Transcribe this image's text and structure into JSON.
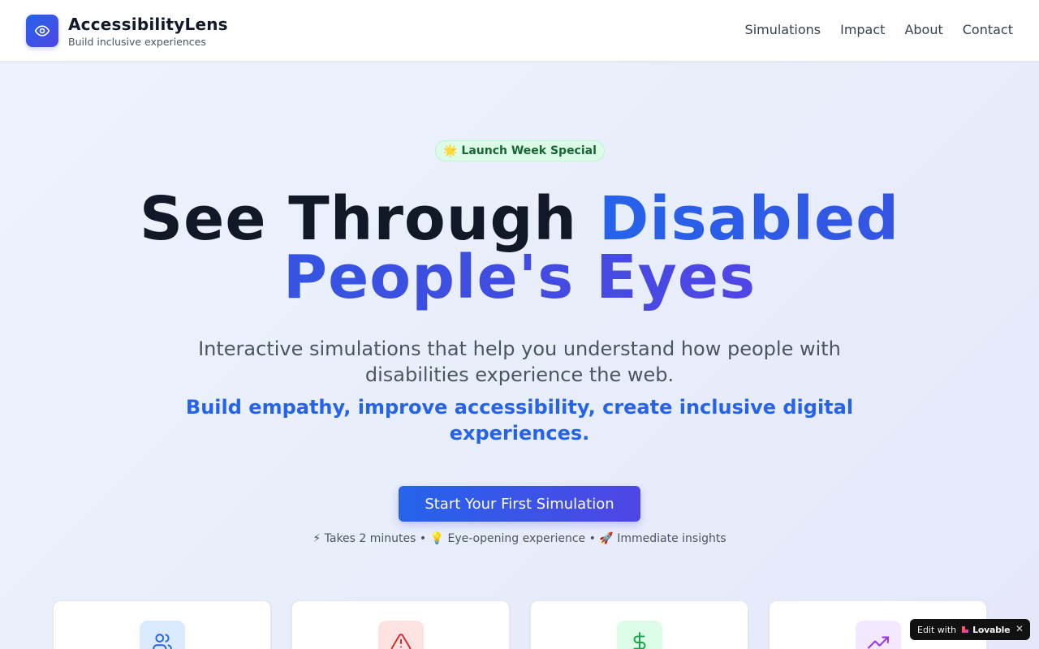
{
  "app": {
    "brand_name": "AccessibilityLens",
    "brand_tagline": "Build inclusive experiences",
    "logo_icon": "eye-icon"
  },
  "nav": {
    "items": [
      {
        "label": "Simulations"
      },
      {
        "label": "Impact"
      },
      {
        "label": "About"
      },
      {
        "label": "Contact"
      }
    ]
  },
  "hero": {
    "badge": "🌟 Launch Week Special",
    "headline_part1": "See Through ",
    "headline_highlight": "Disabled People's Eyes",
    "subtitle": "Interactive simulations that help you understand how people with disabilities experience the web.",
    "subtitle_emphasis": "Build empathy, improve accessibility, create inclusive digital experiences.",
    "cta_label": "Start Your First Simulation",
    "perks": "⚡ Takes 2 minutes • 💡 Eye-opening experience • 🚀 Immediate insights"
  },
  "cards": [
    {
      "icon": "users-icon",
      "color": "#2563eb",
      "bg": "#dbeafe"
    },
    {
      "icon": "warning-icon",
      "color": "#dc2626",
      "bg": "#fee2e2"
    },
    {
      "icon": "dollar-icon",
      "color": "#16a34a",
      "bg": "#dcfce7"
    },
    {
      "icon": "trending-up-icon",
      "color": "#9333ea",
      "bg": "#f3e8ff"
    }
  ],
  "lovable_badge": {
    "prefix": "Edit with",
    "brand": "Lovable",
    "close": "✕"
  },
  "colors": {
    "accent": "#2563eb",
    "accent_secondary": "#4f46e5",
    "badge_bg": "#dcfce7",
    "badge_text": "#166534"
  }
}
